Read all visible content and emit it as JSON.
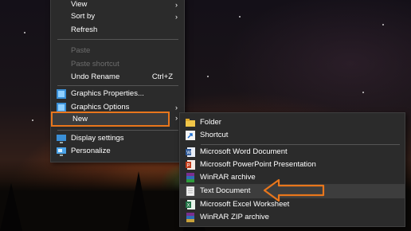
{
  "context_menu": {
    "items": [
      {
        "label": "View",
        "arrow": "›"
      },
      {
        "label": "Sort by",
        "arrow": "›"
      },
      {
        "label": "Refresh"
      },
      {
        "label": "Paste"
      },
      {
        "label": "Paste shortcut"
      },
      {
        "label": "Undo Rename",
        "shortcut": "Ctrl+Z"
      },
      {
        "label": "Graphics Properties..."
      },
      {
        "label": "Graphics Options",
        "arrow": "›"
      },
      {
        "label": "New",
        "arrow": "›"
      },
      {
        "label": "Display settings"
      },
      {
        "label": "Personalize"
      }
    ]
  },
  "new_submenu": {
    "items": [
      {
        "label": "Folder",
        "icon": "folder-icon"
      },
      {
        "label": "Shortcut",
        "icon": "shortcut-icon"
      },
      {
        "label": "Microsoft Word Document",
        "icon": "word-icon"
      },
      {
        "label": "Microsoft PowerPoint Presentation",
        "icon": "powerpoint-icon"
      },
      {
        "label": "WinRAR archive",
        "icon": "winrar-icon"
      },
      {
        "label": "Text Document",
        "icon": "text-document-icon"
      },
      {
        "label": "Microsoft Excel Worksheet",
        "icon": "excel-icon"
      },
      {
        "label": "WinRAR ZIP archive",
        "icon": "winrar-zip-icon"
      }
    ]
  },
  "colors": {
    "menu_bg": "#2b2b2b",
    "highlight_outline": "#e8761c",
    "disabled_text": "#6d6d6d"
  }
}
